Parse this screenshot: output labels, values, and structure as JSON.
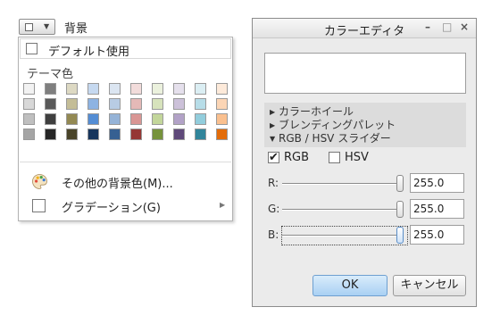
{
  "background_control": {
    "label": "背景",
    "icon": "square-swatch-icon",
    "dropdown_icon": "chevron-down-icon"
  },
  "background_menu": {
    "default_option": "デフォルト使用",
    "theme_colors_title": "テーマ色",
    "theme_colors": [
      [
        "#f2f2f2",
        "#7f7f7f",
        "#ddd9c3",
        "#c6d9f0",
        "#dbe5f1",
        "#f2dcdb",
        "#ebf1dd",
        "#e5e0ec",
        "#dbeef3",
        "#fdeada"
      ],
      [
        "#d8d8d8",
        "#595959",
        "#c4bd97",
        "#8db3e2",
        "#b8cce4",
        "#e5b9b7",
        "#d7e3bc",
        "#ccc1d9",
        "#b7dde8",
        "#fbd5b5"
      ],
      [
        "#bfbfbf",
        "#3f3f3f",
        "#938953",
        "#548dd4",
        "#95b3d7",
        "#d99694",
        "#c3d69b",
        "#b2a2c7",
        "#92cddc",
        "#fac08f"
      ],
      [
        "#a5a5a5",
        "#262626",
        "#494429",
        "#17365d",
        "#366092",
        "#953734",
        "#76923c",
        "#5f497a",
        "#31859b",
        "#e36c09"
      ]
    ],
    "other_colors": "その他の背景色(M)...",
    "gradation": "グラデーション(G)",
    "palette_icon": "paint-palette-icon",
    "submenu_icon": "chevron-right-icon"
  },
  "color_editor": {
    "title": "カラーエディタ",
    "window_buttons": {
      "minimize": "–",
      "maximize": "□",
      "close": "×"
    },
    "preview_color": "#ffffff",
    "sections": [
      {
        "label": "カラーホイール",
        "marker": "▶"
      },
      {
        "label": "ブレンディングパレット",
        "marker": "▶"
      },
      {
        "label": "RGB / HSV スライダー",
        "marker": "▼"
      }
    ],
    "modes": [
      {
        "label": "RGB",
        "checked": true,
        "mark": "✔"
      },
      {
        "label": "HSV",
        "checked": false,
        "mark": ""
      }
    ],
    "sliders": [
      {
        "channel": "R:",
        "value": "255.0",
        "level": 1.0
      },
      {
        "channel": "G:",
        "value": "255.0",
        "level": 1.0
      },
      {
        "channel": "B:",
        "value": "255.0",
        "level": 1.0
      }
    ],
    "ok_label": "OK",
    "cancel_label": "キャンセル",
    "accent": "#a9d0f3"
  }
}
